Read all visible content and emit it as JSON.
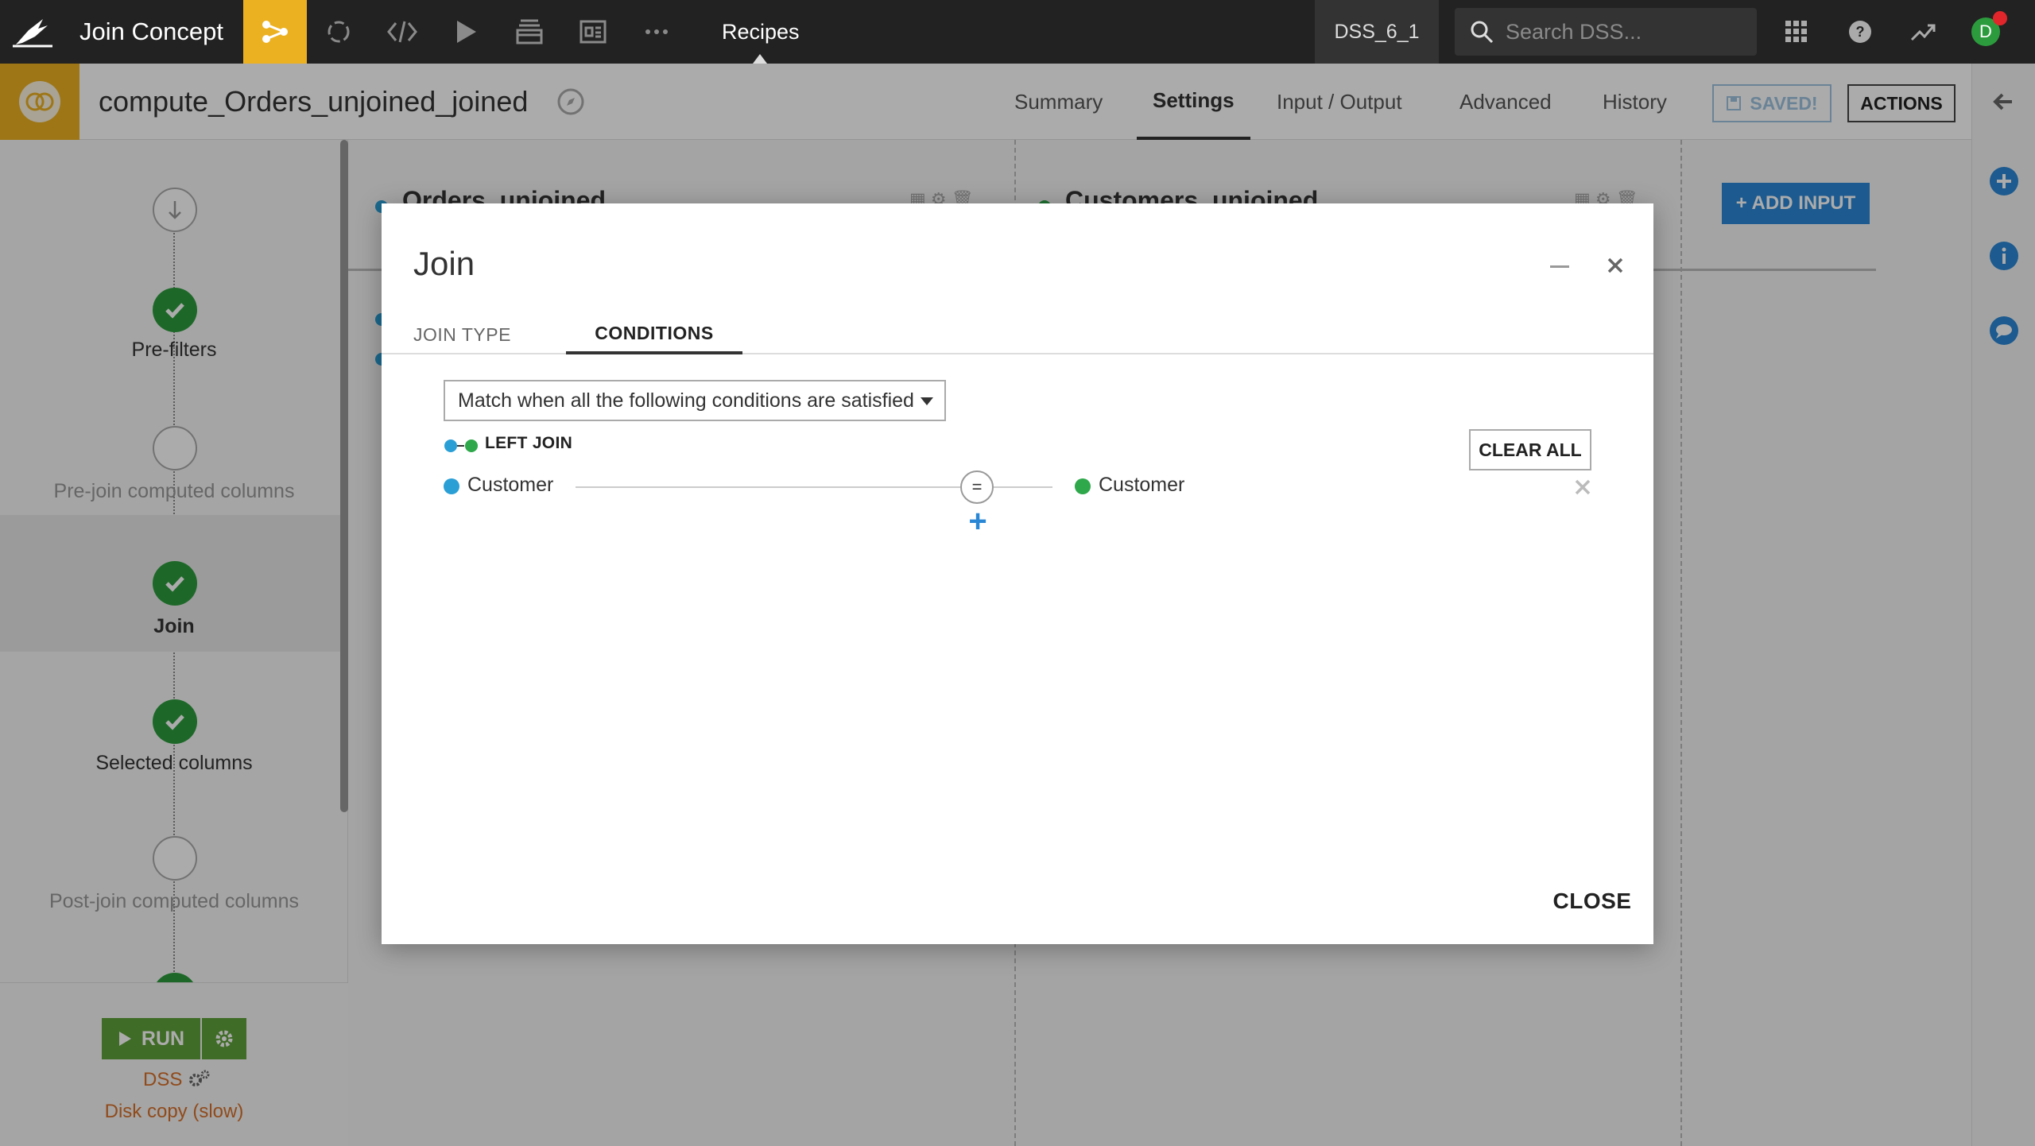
{
  "topbar": {
    "project_name": "Join Concept",
    "section": "Recipes",
    "instance": "DSS_6_1",
    "search_placeholder": "Search DSS...",
    "avatar_initial": "D",
    "nav_icons": [
      "flow-icon",
      "lab-icon",
      "code-icon",
      "run-icon",
      "datasets-icon",
      "dashboard-icon",
      "more-icon"
    ]
  },
  "subheader": {
    "recipe_name": "compute_Orders_unjoined_joined",
    "tabs": [
      {
        "label": "Summary",
        "active": false
      },
      {
        "label": "Settings",
        "active": true
      },
      {
        "label": "Input / Output",
        "active": false
      },
      {
        "label": "Advanced",
        "active": false
      },
      {
        "label": "History",
        "active": false
      }
    ],
    "saved_label": "SAVED!",
    "actions_label": "ACTIONS"
  },
  "steps": [
    {
      "label": "",
      "state": "arrow"
    },
    {
      "label": "Pre-filters",
      "state": "done"
    },
    {
      "label": "Pre-join computed columns",
      "state": "empty"
    },
    {
      "label": "Join",
      "state": "done",
      "active": true
    },
    {
      "label": "Selected columns",
      "state": "done"
    },
    {
      "label": "Post-join computed columns",
      "state": "empty"
    }
  ],
  "run": {
    "label": "RUN",
    "engine": "DSS",
    "engine_mode": "Disk copy (slow)"
  },
  "main": {
    "left_dataset": "Orders_unjoined",
    "right_dataset": "Customers_unjoined",
    "add_input_label": "+ ADD INPUT"
  },
  "modal": {
    "title": "Join",
    "tabs": [
      {
        "label": "JOIN TYPE",
        "active": false
      },
      {
        "label": "CONDITIONS",
        "active": true
      }
    ],
    "match_mode": "Match when all the following conditions are satisfied",
    "join_type": "LEFT JOIN",
    "clear_all_label": "CLEAR ALL",
    "condition": {
      "left_column": "Customer",
      "operator": "=",
      "right_column": "Customer"
    },
    "add_condition": "+",
    "close_label": "CLOSE"
  },
  "colors": {
    "accent": "#ecb121",
    "left_dataset": "#2a9fd6",
    "right_dataset": "#2ea84a",
    "run": "#5ea23a",
    "primary_button": "#2a87d6"
  }
}
